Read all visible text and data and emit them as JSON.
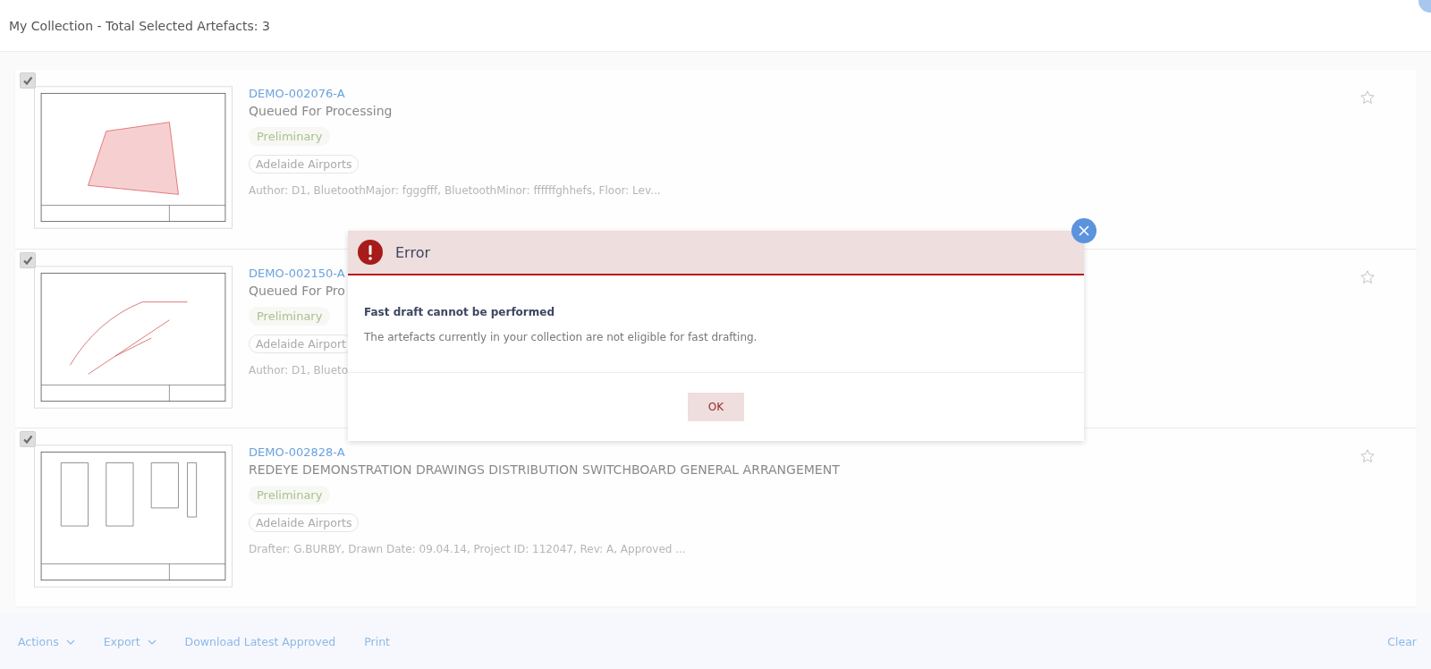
{
  "header": {
    "title": "My Collection - Total Selected Artefacts: 3"
  },
  "artefacts": [
    {
      "checked": true,
      "starred": false,
      "id": "DEMO-002076-A",
      "title": "Queued For Processing",
      "status": "Preliminary",
      "organisation": "Adelaide Airports",
      "meta": "Author: D1, BluetoothMajor: fgggfff, BluetoothMinor: ffffffghhefs, Floor: Lev..."
    },
    {
      "checked": true,
      "starred": false,
      "id": "DEMO-002150-A",
      "title": "Queued For Pro",
      "status": "Preliminary",
      "organisation": "Adelaide Airport",
      "meta": "Author: D1, Blueto"
    },
    {
      "checked": true,
      "starred": false,
      "id": "DEMO-002828-A",
      "title": "REDEYE DEMONSTRATION DRAWINGS DISTRIBUTION SWITCHBOARD GENERAL ARRANGEMENT",
      "status": "Preliminary",
      "organisation": "Adelaide Airports",
      "meta": "Drafter: G.BURBY, Drawn Date: 09.04.14, Project ID: 112047, Rev: A, Approved ..."
    }
  ],
  "footer": {
    "actions": [
      {
        "label": "Actions",
        "kind": "dropdown"
      },
      {
        "label": "Export",
        "kind": "dropdown"
      },
      {
        "label": "Download Latest Approved",
        "kind": "link"
      },
      {
        "label": "Print",
        "kind": "link"
      }
    ],
    "clear": "Clear"
  },
  "dialog": {
    "title": "Error",
    "heading": "Fast draft cannot be performed",
    "message": "The artefacts currently in your collection are not eligible for fast drafting.",
    "button": "OK"
  }
}
